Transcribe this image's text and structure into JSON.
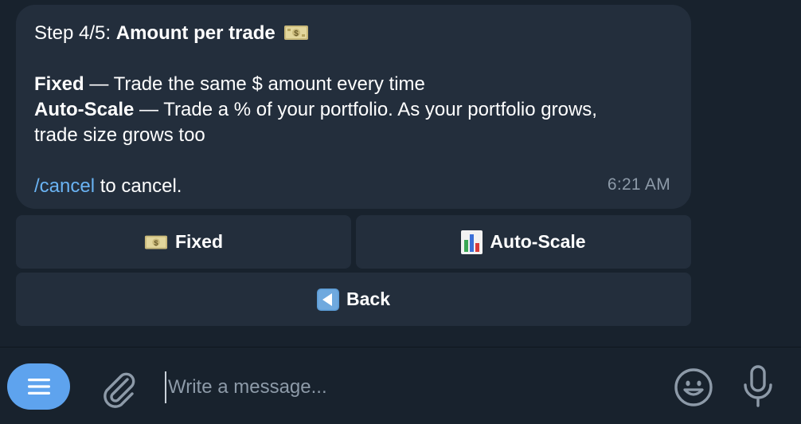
{
  "message": {
    "step_prefix": "Step 4/5: ",
    "step_title": "Amount per trade",
    "fixed_label": "Fixed",
    "fixed_desc": " — Trade the same $ amount every time",
    "autoscale_label": "Auto-Scale",
    "autoscale_desc_1": " — Trade a % of your portfolio. As your portfolio grows,",
    "autoscale_desc_2": "trade size grows too",
    "cancel_command": "/cancel",
    "cancel_suffix": " to cancel.",
    "time": "6:21 AM"
  },
  "keyboard": {
    "fixed_label": "Fixed",
    "autoscale_label": "Auto-Scale",
    "back_label": "Back"
  },
  "composer": {
    "placeholder": "Write a message..."
  },
  "icons": {
    "money": "money-icon",
    "chart": "bar-chart-icon",
    "back": "back-arrow-icon",
    "menu": "menu-icon",
    "attach": "paperclip-icon",
    "emoji": "smiley-icon",
    "mic": "microphone-icon"
  },
  "colors": {
    "background": "#18222d",
    "bubble": "#232e3c",
    "link": "#6ab3f3",
    "menu_button": "#5ea3ee",
    "muted_text": "#8d9aa8"
  }
}
